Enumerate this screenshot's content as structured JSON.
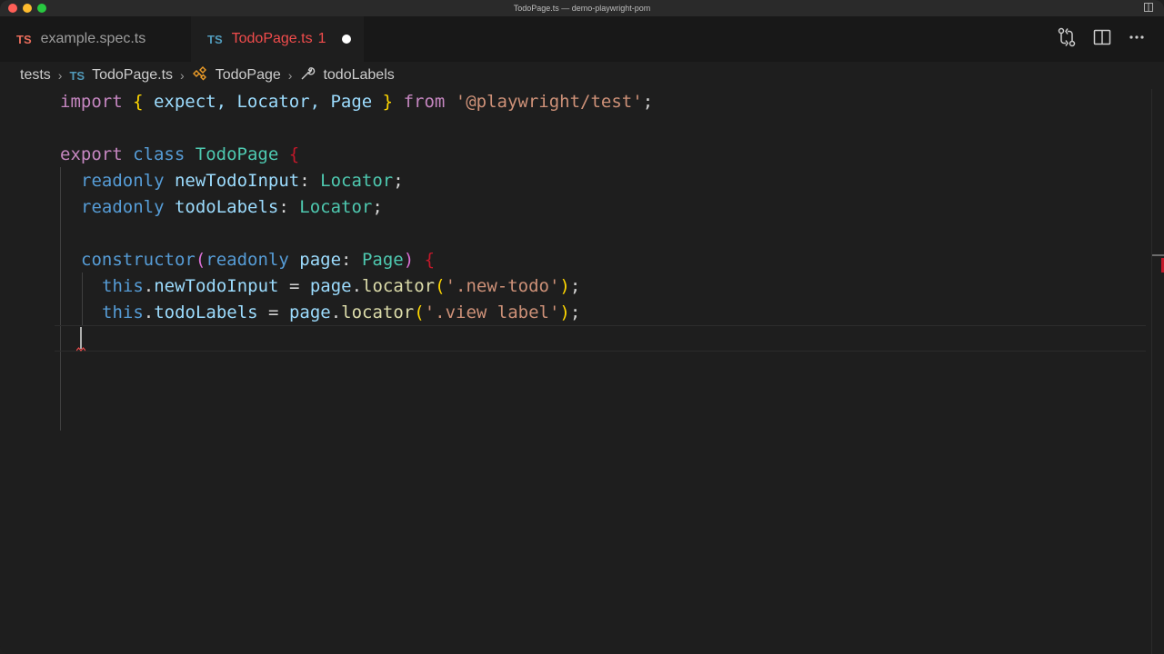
{
  "window": {
    "title": "TodoPage.ts — demo-playwright-pom"
  },
  "tabs": [
    {
      "lang": "TS",
      "label": "example.spec.ts",
      "active": false
    },
    {
      "lang": "TS",
      "label": "TodoPage.ts",
      "problems": "1",
      "active": true,
      "dirty": true
    }
  ],
  "tab_actions": [
    "source-control-compare-icon",
    "split-editor-icon",
    "more-actions-icon"
  ],
  "breadcrumb": {
    "folder": "tests",
    "file_lang": "TS",
    "file": "TodoPage.ts",
    "class": "TodoPage",
    "member": "todoLabels"
  },
  "code": {
    "l1": {
      "import": "import",
      "brace_open": "{",
      "names": " expect, Locator, Page ",
      "brace_close": "}",
      "from": "from",
      "module": "'@playwright/test'",
      "semi": ";"
    },
    "l3": {
      "export": "export",
      "class": "class",
      "name": "TodoPage",
      "brace": "{"
    },
    "l4": {
      "readonly": "readonly",
      "prop": "newTodoInput",
      "colon": ":",
      "type": "Locator",
      "semi": ";"
    },
    "l5": {
      "readonly": "readonly",
      "prop": "todoLabels",
      "colon": ":",
      "type": "Locator",
      "semi": ";"
    },
    "l7": {
      "ctor": "constructor",
      "paren_open": "(",
      "readonly": "readonly",
      "param": "page",
      "colon": ":",
      "type": "Page",
      "paren_close": ")",
      "brace": "{"
    },
    "l8": {
      "this": "this",
      "dot": ".",
      "prop": "newTodoInput",
      "eq": " = ",
      "obj": "page",
      "dot2": ".",
      "fn": "locator",
      "paren_open": "(",
      "arg": "'.new-todo'",
      "paren_close": ")",
      "semi": ";"
    },
    "l9": {
      "this": "this",
      "dot": ".",
      "prop": "todoLabels",
      "eq": " = ",
      "obj": "page",
      "dot2": ".",
      "fn": "locator",
      "paren_open": "(",
      "arg": "'.view label'",
      "paren_close": ")",
      "semi": ";"
    }
  },
  "colors": {
    "keyword_pink": "#c586c0",
    "keyword_blue": "#569cd6",
    "identifier": "#9cdcfe",
    "type": "#4ec9b0",
    "string": "#ce9178",
    "function": "#dcdcaa",
    "error": "#f14c4c"
  }
}
